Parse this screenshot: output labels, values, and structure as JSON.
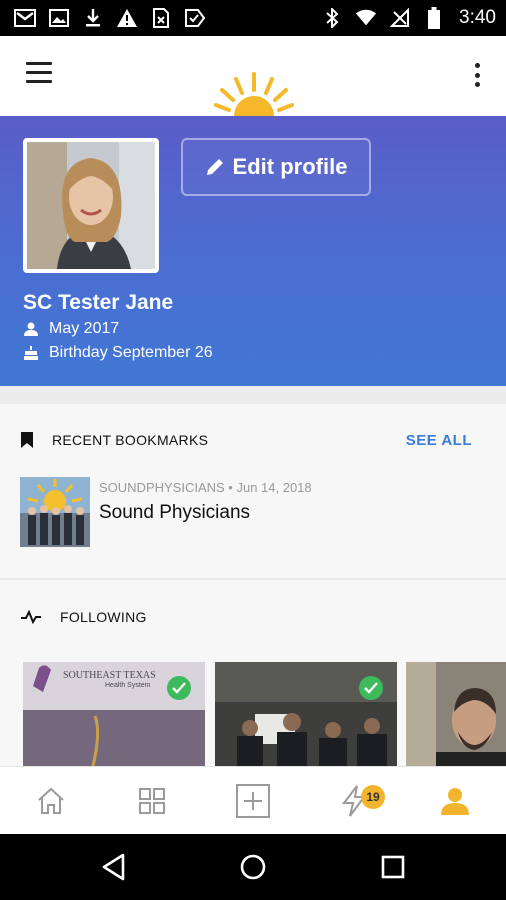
{
  "status_bar": {
    "time": "3:40",
    "left_icons": [
      "gmail-icon",
      "image-icon",
      "download-icon",
      "warning-icon",
      "sim-icon",
      "task-icon"
    ],
    "right_icons": [
      "bluetooth-icon",
      "wifi-icon",
      "no-signal-icon",
      "battery-icon"
    ]
  },
  "header": {
    "logo": "sun-logo"
  },
  "profile": {
    "edit_label": "Edit profile",
    "name": "SC Tester Jane",
    "joined": "May 2017",
    "birthday": "Birthday September 26",
    "accent": "#4a6ed2"
  },
  "bookmarks": {
    "heading": "RECENT BOOKMARKS",
    "see_all": "SEE ALL",
    "items": [
      {
        "meta": "SOUNDPHYSICIANS • Jun 14, 2018",
        "title": "Sound Physicians"
      }
    ]
  },
  "following": {
    "heading": "FOLLOWING",
    "cards": [
      {
        "caption": "SOUTHEAST TEXAS",
        "sub": "Health System",
        "following": true
      },
      {
        "following": true
      },
      {
        "following": false
      }
    ]
  },
  "bottom_nav": {
    "items": [
      "home-icon",
      "grid-icon",
      "add-icon",
      "activity-icon",
      "profile-icon"
    ],
    "badge": "19",
    "active_color": "#f2b42c"
  }
}
